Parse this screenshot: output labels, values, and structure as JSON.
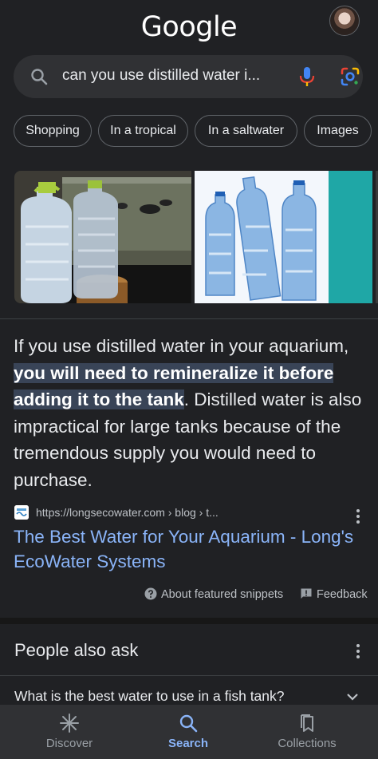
{
  "header": {
    "logo_text": "Google"
  },
  "search": {
    "query": "can you use distilled water i..."
  },
  "chips": [
    "Shopping",
    "In a tropical",
    "In a saltwater",
    "Images"
  ],
  "images": [
    {
      "icon": "jug-and-aquarium-photo"
    },
    {
      "icon": "plastic-bottles-photo"
    }
  ],
  "snippet": {
    "before": "If you use distilled water in your aquarium, ",
    "highlight": "you will need to remineralize it before adding it to the tank",
    "after": ". Distilled water is also impractical for large tanks because of the tremendous supply you would need to purchase."
  },
  "result": {
    "source": "https://longsecowater.com › blog › t...",
    "title": "The Best Water for Your Aquarium - Long's EcoWater Systems"
  },
  "footer": {
    "about": "About featured snippets",
    "feedback": "Feedback"
  },
  "paa": {
    "title": "People also ask",
    "questions": [
      "What is the best water to use in a fish tank?"
    ]
  },
  "nav": {
    "items": [
      {
        "label": "Discover",
        "icon": "asterisk-icon"
      },
      {
        "label": "Search",
        "icon": "search-icon"
      },
      {
        "label": "Collections",
        "icon": "bookmark-stack-icon"
      }
    ],
    "active": "Search"
  },
  "colors": {
    "background": "#202124",
    "link": "#8ab4f8",
    "highlight": "#394457",
    "surface": "#303134"
  }
}
